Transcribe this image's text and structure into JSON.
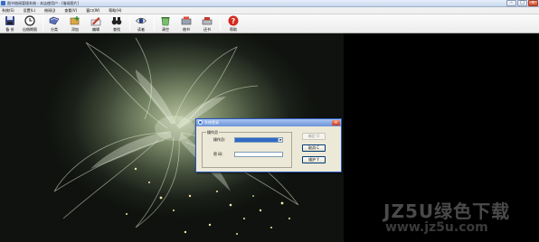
{
  "window": {
    "title": "图书借阅管理系统 - 本店使用户 - [借阅图片]"
  },
  "menu": [
    "系统(S)",
    "设置(L)",
    "借阅(J)",
    "查看(V)",
    "窗口(W)",
    "帮助(H)"
  ],
  "toolbar": {
    "items": [
      {
        "label": "备 份",
        "icon": "disk-icon"
      },
      {
        "label": "出借期限",
        "icon": "clock-icon"
      },
      {
        "label": "分类",
        "icon": "folder-icon"
      },
      {
        "label": "添加",
        "icon": "add-book-icon"
      },
      {
        "label": "编辑",
        "icon": "edit-icon"
      },
      {
        "label": "查找",
        "icon": "binoculars-icon"
      },
      {
        "label": "读者",
        "icon": "eye-icon"
      },
      {
        "label": "清空",
        "icon": "recycle-bin-icon"
      },
      {
        "label": "借书",
        "icon": "borrow-icon"
      },
      {
        "label": "还书",
        "icon": "return-icon"
      },
      {
        "label": "帮助",
        "icon": "help-icon"
      }
    ]
  },
  "login_dialog": {
    "title": "系统登录",
    "group_label": "操作员",
    "operator_label": "操作员:",
    "password_label": "密  码:",
    "operator_value": "",
    "password_value": "",
    "ok_button": "确定 O",
    "cancel_button": "取消 C",
    "maintain_button": "维护 Y"
  },
  "watermark": {
    "brand": "JZ5U绿色下载",
    "url": "www.jz5u.com"
  },
  "colors": {
    "selection": "#316ac5",
    "dialog_bg": "#ece9d8",
    "title_blue": "#6a92d8"
  }
}
